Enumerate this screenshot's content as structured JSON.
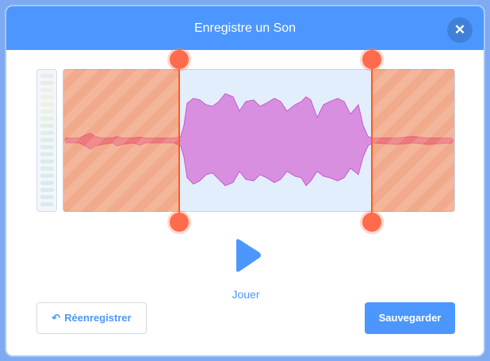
{
  "header": {
    "title": "Enregistre un Son",
    "close_icon": "close-icon"
  },
  "recording": {
    "level_meter_icon": "volume-level-meter",
    "trim": {
      "start_fraction": 0.295,
      "end_fraction": 0.79
    }
  },
  "playback": {
    "play_icon": "play-icon",
    "play_label": "Jouer"
  },
  "actions": {
    "rerecord_icon": "undo-arrow-icon",
    "rerecord_label": "Réenregistrer",
    "save_label": "Sauvegarder"
  },
  "colors": {
    "primary": "#4c97ff",
    "trim_handle": "#ff6c4b",
    "waveform": "#d98fdf"
  }
}
